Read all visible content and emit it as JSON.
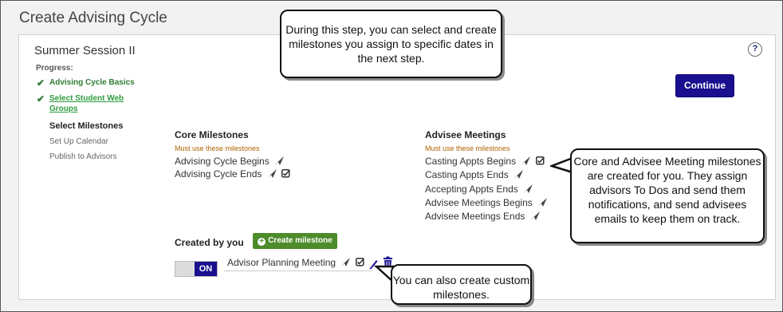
{
  "page": {
    "title": "Create Advising Cycle"
  },
  "session": {
    "title": "Summer Session II"
  },
  "help": {
    "label": "?"
  },
  "progress": {
    "label": "Progress:",
    "steps": [
      {
        "label": "Advising Cycle Basics",
        "state": "done"
      },
      {
        "label": "Select Student Web Groups",
        "state": "done-link"
      },
      {
        "label": "Select Milestones",
        "state": "current"
      },
      {
        "label": "Set Up Calendar",
        "state": "future"
      },
      {
        "label": "Publish to Advisors",
        "state": "future"
      }
    ]
  },
  "actions": {
    "continue_label": "Continue"
  },
  "core_milestones": {
    "heading": "Core Milestones",
    "note": "Must use these milestones",
    "items": [
      {
        "label": "Advising Cycle Begins",
        "icons": [
          "send-icon"
        ]
      },
      {
        "label": "Advising Cycle Ends",
        "icons": [
          "send-icon",
          "todo-check-icon"
        ]
      }
    ]
  },
  "advisee_meetings": {
    "heading": "Advisee Meetings",
    "note": "Must use these milestones",
    "items": [
      {
        "label": "Casting Appts Begins",
        "icons": [
          "send-icon",
          "todo-check-icon"
        ]
      },
      {
        "label": "Casting Appts Ends",
        "icons": [
          "send-icon"
        ]
      },
      {
        "label": "Accepting Appts Ends",
        "icons": [
          "send-icon"
        ]
      },
      {
        "label": "Advisee Meetings Begins",
        "icons": [
          "send-icon"
        ]
      },
      {
        "label": "Advisee Meetings Ends",
        "icons": [
          "send-icon"
        ]
      }
    ]
  },
  "custom": {
    "heading": "Created by you",
    "create_label": "Create milestone",
    "toggle_label": "ON",
    "items": [
      {
        "label": "Advisor Planning Meeting",
        "icons": [
          "send-icon",
          "todo-check-icon",
          "edit-icon",
          "trash-icon"
        ]
      }
    ]
  },
  "callouts": {
    "step_info": "During this step, you can select and create milestones you assign to specific dates in the next step.",
    "core_info": "Core and Advisee Meeting milestones are created for you. They assign advisors To Dos and send them notifications, and send advisees emails to keep them on track.",
    "custom_info": "You can also create custom milestones."
  },
  "colors": {
    "primary": "#1a0f8f",
    "success": "#2e7d32",
    "create": "#4d8b2b",
    "note": "#b06000"
  }
}
